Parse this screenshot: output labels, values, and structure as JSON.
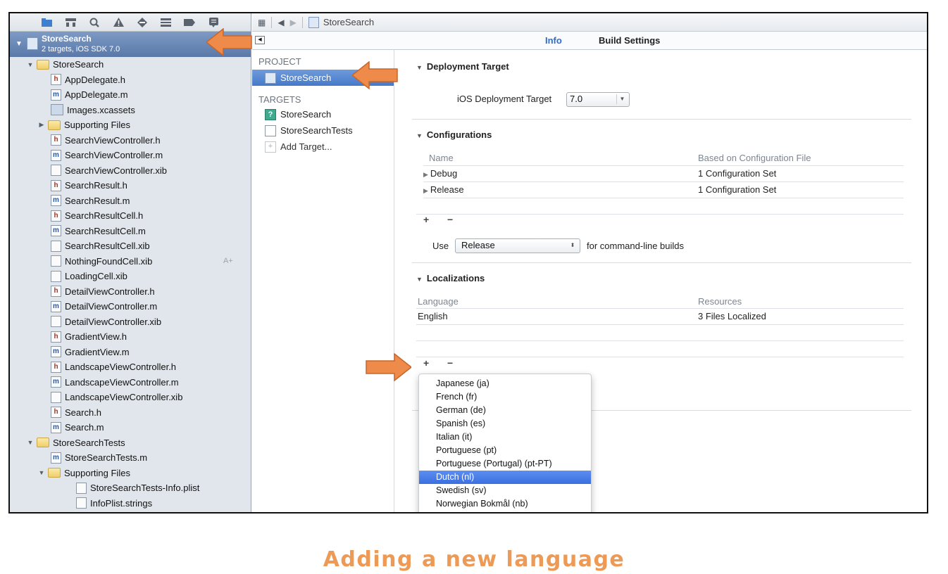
{
  "navigator": {
    "toolbar_icons": [
      "folder-icon",
      "hierarchy-icon",
      "search-icon",
      "warning-icon",
      "breakpoint-diamond-icon",
      "list-icon",
      "tag-icon",
      "log-bubble-icon"
    ],
    "project": {
      "name": "StoreSearch",
      "subtitle": "2 targets, iOS SDK 7.0"
    },
    "tree": [
      {
        "label": "StoreSearch",
        "type": "group",
        "depth": 1,
        "disclosure": "▼"
      },
      {
        "label": "AppDelegate.h",
        "type": "h",
        "depth": 2
      },
      {
        "label": "AppDelegate.m",
        "type": "m",
        "depth": 2
      },
      {
        "label": "Images.xcassets",
        "type": "asset",
        "depth": 2
      },
      {
        "label": "Supporting Files",
        "type": "group",
        "depth": 2,
        "disclosure": "▶"
      },
      {
        "label": "SearchViewController.h",
        "type": "h",
        "depth": 2
      },
      {
        "label": "SearchViewController.m",
        "type": "m",
        "depth": 2
      },
      {
        "label": "SearchViewController.xib",
        "type": "xib",
        "depth": 2
      },
      {
        "label": "SearchResult.h",
        "type": "h",
        "depth": 2
      },
      {
        "label": "SearchResult.m",
        "type": "m",
        "depth": 2
      },
      {
        "label": "SearchResultCell.h",
        "type": "h",
        "depth": 2
      },
      {
        "label": "SearchResultCell.m",
        "type": "m",
        "depth": 2
      },
      {
        "label": "SearchResultCell.xib",
        "type": "xib",
        "depth": 2
      },
      {
        "label": "NothingFoundCell.xib",
        "type": "xib",
        "depth": 2,
        "badge": "A+"
      },
      {
        "label": "LoadingCell.xib",
        "type": "xib",
        "depth": 2
      },
      {
        "label": "DetailViewController.h",
        "type": "h",
        "depth": 2
      },
      {
        "label": "DetailViewController.m",
        "type": "m",
        "depth": 2
      },
      {
        "label": "DetailViewController.xib",
        "type": "xib",
        "depth": 2
      },
      {
        "label": "GradientView.h",
        "type": "h",
        "depth": 2
      },
      {
        "label": "GradientView.m",
        "type": "m",
        "depth": 2
      },
      {
        "label": "LandscapeViewController.h",
        "type": "h",
        "depth": 2
      },
      {
        "label": "LandscapeViewController.m",
        "type": "m",
        "depth": 2
      },
      {
        "label": "LandscapeViewController.xib",
        "type": "xib",
        "depth": 2
      },
      {
        "label": "Search.h",
        "type": "h",
        "depth": 2
      },
      {
        "label": "Search.m",
        "type": "m",
        "depth": 2
      },
      {
        "label": "StoreSearchTests",
        "type": "group",
        "depth": 1,
        "disclosure": "▼"
      },
      {
        "label": "StoreSearchTests.m",
        "type": "m",
        "depth": 2
      },
      {
        "label": "Supporting Files",
        "type": "group",
        "depth": 2,
        "disclosure": "▼"
      },
      {
        "label": "StoreSearchTests-Info.plist",
        "type": "plist",
        "depth": 3
      },
      {
        "label": "InfoPlist.strings",
        "type": "plist",
        "depth": 3
      }
    ]
  },
  "jumpbar": {
    "file": "StoreSearch",
    "back_glyph": "◀",
    "forward_glyph": "▶",
    "grid_glyph": "▦"
  },
  "tabs": {
    "info": "Info",
    "build_settings": "Build Settings"
  },
  "targets": {
    "project_header": "PROJECT",
    "project_item": "StoreSearch",
    "targets_header": "TARGETS",
    "target_items": [
      "StoreSearch",
      "StoreSearchTests"
    ],
    "add_target": "Add Target..."
  },
  "deployment": {
    "title": "Deployment Target",
    "label": "iOS Deployment Target",
    "value": "7.0"
  },
  "configurations": {
    "title": "Configurations",
    "col_name": "Name",
    "col_based": "Based on Configuration File",
    "rows": [
      {
        "name": "Debug",
        "based": "1 Configuration Set"
      },
      {
        "name": "Release",
        "based": "1 Configuration Set"
      }
    ],
    "use_label": "Use",
    "use_value": "Release",
    "use_suffix": "for command-line builds"
  },
  "localizations": {
    "title": "Localizations",
    "col_language": "Language",
    "col_resources": "Resources",
    "rows": [
      {
        "language": "English",
        "resources": "3 Files Localized"
      }
    ]
  },
  "controls": {
    "add": "+",
    "remove": "−"
  },
  "language_menu": {
    "items": [
      "Japanese (ja)",
      "French (fr)",
      "German (de)",
      "Spanish (es)",
      "Italian (it)",
      "Portuguese (pt)",
      "Portuguese (Portugal) (pt-PT)",
      "Dutch (nl)",
      "Swedish (sv)",
      "Norwegian Bokmål (nb)"
    ],
    "highlighted": "Dutch (nl)"
  },
  "caption": "Adding a new language",
  "colors": {
    "accent_orange": "#ee8a4a",
    "selection_blue": "#4679c8",
    "caption_orange": "#ec9a55"
  }
}
